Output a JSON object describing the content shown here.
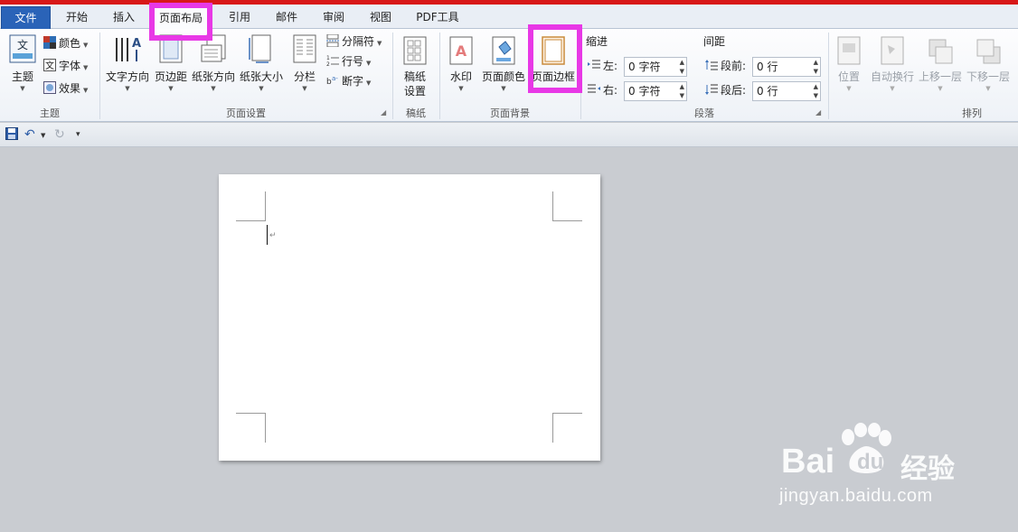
{
  "tabs": [
    "文件",
    "开始",
    "插入",
    "页面布局",
    "引用",
    "邮件",
    "审阅",
    "视图",
    "PDF工具"
  ],
  "active_tab": "页面布局",
  "groups": {
    "theme": {
      "label": "主题",
      "theme_button": "主题",
      "colors": "颜色",
      "fonts": "字体",
      "effects": "效果"
    },
    "page_setup": {
      "label": "页面设置",
      "text_direction": "文字方向",
      "margins": "页边距",
      "orientation": "纸张方向",
      "size": "纸张大小",
      "columns": "分栏",
      "breaks": "分隔符",
      "line_numbers": "行号",
      "hyphenation": "断字"
    },
    "draft_paper": {
      "label": "稿纸",
      "settings_line1": "稿纸",
      "settings_line2": "设置"
    },
    "page_background": {
      "label": "页面背景",
      "watermark": "水印",
      "page_color": "页面颜色",
      "page_borders": "页面边框"
    },
    "paragraph": {
      "label": "段落",
      "indent_title": "缩进",
      "indent_left_label": "左:",
      "indent_left_value": "0 字符",
      "indent_right_label": "右:",
      "indent_right_value": "0 字符",
      "spacing_title": "间距",
      "before_label": "段前:",
      "before_value": "0 行",
      "after_label": "段后:",
      "after_value": "0 行"
    },
    "arrange": {
      "label": "排列",
      "position": "位置",
      "wrap_text": "自动换行",
      "bring_forward": "上移一层",
      "send_backward": "下移一层"
    }
  },
  "watermark_brand": {
    "bai": "Bai",
    "du": "du",
    "jingyan": "经验",
    "url": "jingyan.baidu.com"
  },
  "colors": {
    "highlight": "#e838e6",
    "file_tab": "#2a63b8",
    "top_bar": "#d81818"
  }
}
